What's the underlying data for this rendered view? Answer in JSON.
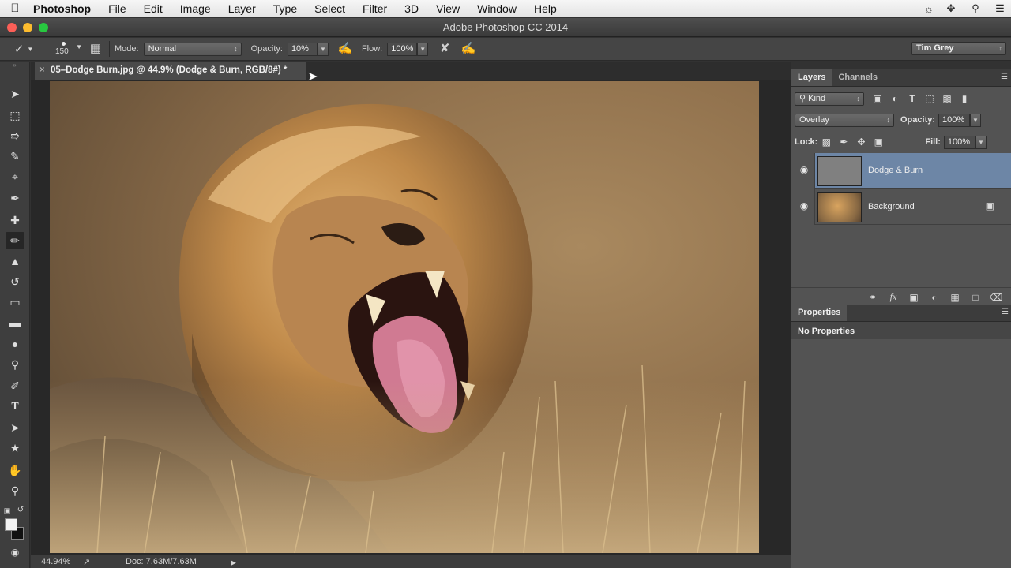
{
  "menubar": {
    "apple_icon": "apple-icon",
    "items": [
      "Photoshop",
      "File",
      "Edit",
      "Image",
      "Layer",
      "Type",
      "Select",
      "Filter",
      "3D",
      "View",
      "Window",
      "Help"
    ]
  },
  "window": {
    "title": "Adobe Photoshop CC 2014",
    "traffic_lights": [
      "#fc5f57",
      "#fdbc2e",
      "#28c840"
    ]
  },
  "options": {
    "brush_size": "150",
    "mode_label": "Mode:",
    "mode_value": "Normal",
    "opacity_label": "Opacity:",
    "opacity_value": "10%",
    "flow_label": "Flow:",
    "flow_value": "100%",
    "workspace": "Tim Grey"
  },
  "document": {
    "tab_title": "05–Dodge Burn.jpg @ 44.9% (Dodge & Burn, RGB/8#) *",
    "close_glyph": "×"
  },
  "status": {
    "zoom": "44.94%",
    "doc_info": "Doc: 7.63M/7.63M"
  },
  "layers_panel": {
    "tabs": [
      "Layers",
      "Channels"
    ],
    "filter_kind": "Kind",
    "blend_mode": "Overlay",
    "opacity_label": "Opacity:",
    "opacity_value": "100%",
    "lock_label": "Lock:",
    "fill_label": "Fill:",
    "fill_value": "100%",
    "layers": [
      {
        "name": "Dodge & Burn",
        "selected": true,
        "locked": false
      },
      {
        "name": "Background",
        "selected": false,
        "locked": true
      }
    ],
    "selection_color": "#6d86a6"
  },
  "properties_panel": {
    "tab": "Properties",
    "message": "No Properties"
  }
}
